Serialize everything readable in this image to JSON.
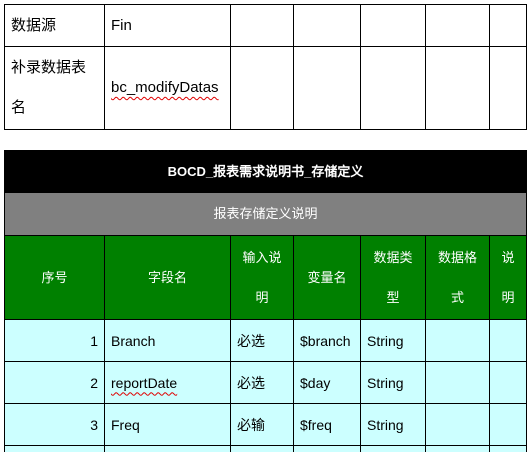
{
  "info_table": {
    "rows": [
      {
        "label": "数据源",
        "value": "Fin"
      },
      {
        "label": "补录数据表名",
        "value": "bc_modifyDatas"
      }
    ]
  },
  "storage_table": {
    "title": "BOCD_报表需求说明书_存储定义",
    "subtitle": "报表存储定义说明",
    "headers": [
      "序号",
      "字段名",
      "输入说明",
      "变量名",
      "数据类型",
      "数据格式",
      "说明"
    ],
    "rows": [
      {
        "no": "1",
        "field": "Branch",
        "input": "必选",
        "variable": "$branch",
        "data_type": "String"
      },
      {
        "no": "2",
        "field": "reportDate",
        "input": "必选",
        "variable": "$day",
        "data_type": "String"
      },
      {
        "no": "3",
        "field": "Freq",
        "input": "必输",
        "variable": "$freq",
        "data_type": "String"
      }
    ]
  },
  "colors": {
    "title_bg": "#000000",
    "subtitle_bg": "#808080",
    "header_bg": "#008000",
    "row_bg": "#CCFFFF",
    "header_text": "#FFFFFF",
    "border": "#000000",
    "spellcheck_underline": "#E00000"
  }
}
